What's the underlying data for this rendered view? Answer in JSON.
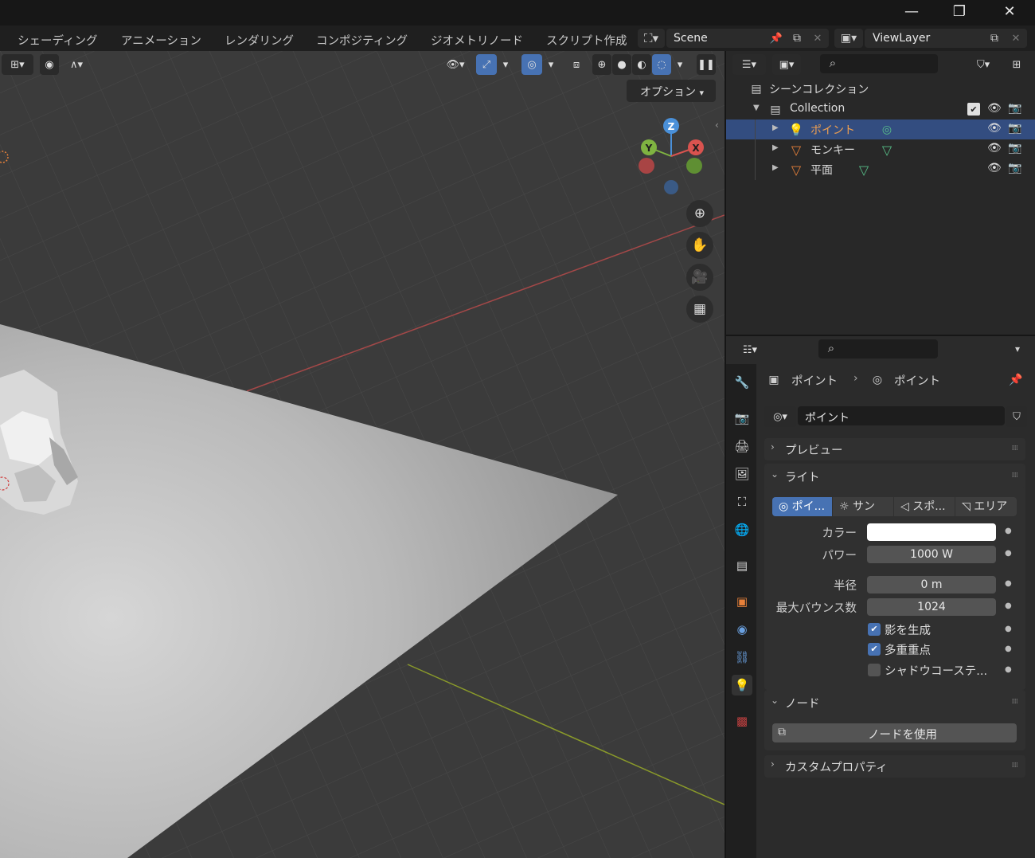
{
  "window": {
    "minimize": "—",
    "maximize": "❐",
    "close": "✕"
  },
  "workspaces": [
    "シェーディング",
    "アニメーション",
    "レンダリング",
    "コンポジティング",
    "ジオメトリノード",
    "スクリプト作成"
  ],
  "scene": {
    "name": "Scene"
  },
  "view_layer": {
    "name": "ViewLayer"
  },
  "viewport": {
    "options_label": "オプション",
    "gizmo": {
      "z": "Z",
      "y": "Y",
      "x": "X"
    }
  },
  "outliner": {
    "search_placeholder": "",
    "root": "シーンコレクション",
    "collection": "Collection",
    "items": [
      {
        "label": "ポイント",
        "icon": "light-icon",
        "selected": true
      },
      {
        "label": "モンキー",
        "icon": "mesh-icon",
        "selected": false
      },
      {
        "label": "平面",
        "icon": "mesh-icon",
        "selected": false
      }
    ]
  },
  "properties": {
    "search_placeholder": "",
    "breadcrumb": {
      "object": "ポイント",
      "data": "ポイント"
    },
    "datablock_name": "ポイント",
    "panels": {
      "preview": "プレビュー",
      "light": "ライト",
      "nodes": "ノード",
      "custom": "カスタムプロパティ"
    },
    "light_types": [
      "ポイ...",
      "サン",
      "スポ...",
      "エリア"
    ],
    "fields": {
      "color_label": "カラー",
      "color_value": "#ffffff",
      "power_label": "パワー",
      "power_value": "1000 W",
      "radius_label": "半径",
      "radius_value": "0 m",
      "bounces_label": "最大バウンス数",
      "bounces_value": "1024"
    },
    "checkboxes": {
      "cast_shadow": "影を生成",
      "multiple_importance": "多重重点",
      "shadow_caustics": "シャドウコーステ..."
    },
    "use_nodes_label": "ノードを使用"
  },
  "colors": {
    "accent": "#4772b3",
    "selected_row": "#334d80",
    "light_orange": "#e8a04a",
    "mesh_orange": "#e8813a",
    "green_icon": "#58c08a"
  }
}
